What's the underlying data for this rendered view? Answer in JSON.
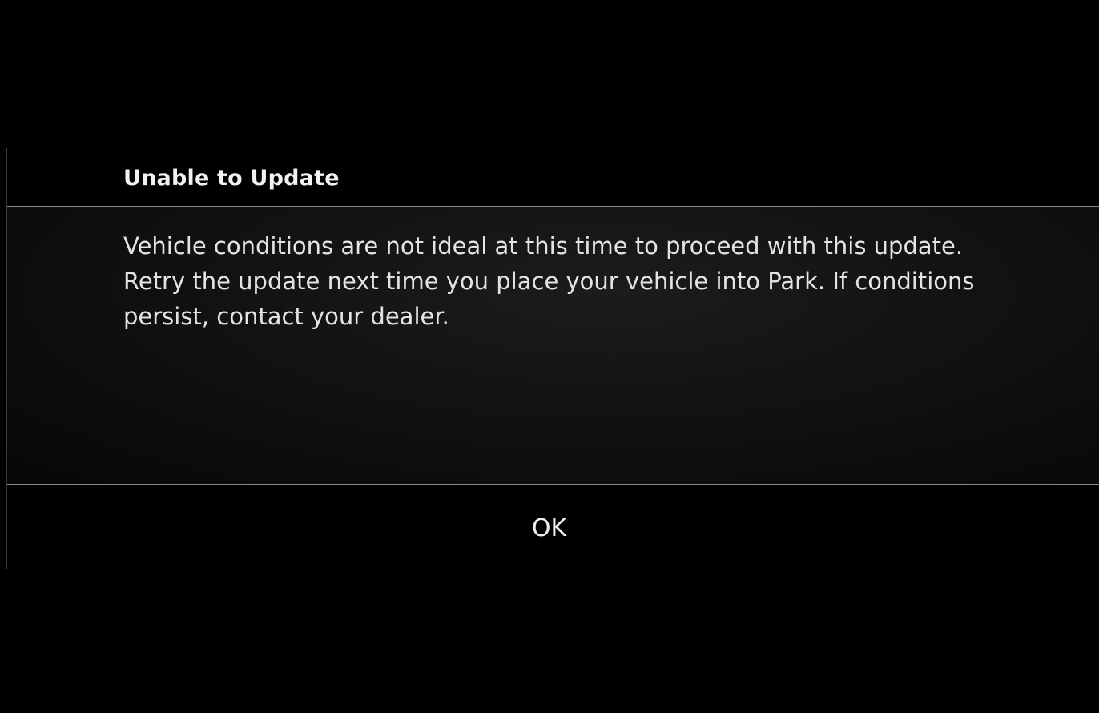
{
  "dialog": {
    "title": "Unable to Update",
    "message": "Vehicle conditions are not ideal at this time to proceed with this update. Retry the update next time you place your vehicle into Park. If conditions persist, contact your dealer.",
    "ok_label": "OK"
  },
  "colors": {
    "background": "#000000",
    "text": "#e4e4e4",
    "divider": "#8a8a8a"
  }
}
